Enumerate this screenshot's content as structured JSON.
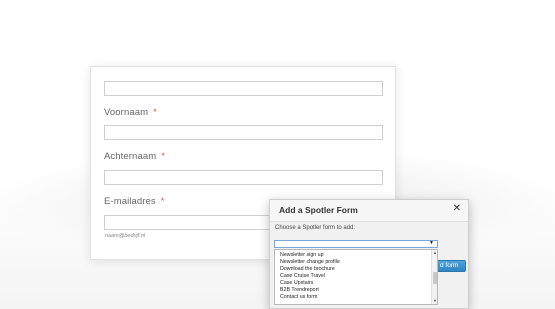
{
  "form": {
    "fields": [
      {
        "label": "",
        "required": false,
        "value": ""
      },
      {
        "label": "Voornaam",
        "required": true,
        "value": ""
      },
      {
        "label": "Achternaam",
        "required": true,
        "value": ""
      },
      {
        "label": "E-mailadres",
        "required": true,
        "value": ""
      }
    ],
    "required_marker": "*",
    "email_hint": "naam@bedrijf.nl"
  },
  "modal": {
    "title": "Add a Spotler Form",
    "close_icon": "close-icon",
    "prompt": "Choose a Spotler form to add:",
    "select": {
      "value": "",
      "options": [
        "Newsletter sign up",
        "Newsletter change profile",
        "Download the brochure",
        "Case Cruise Travel",
        "Case Upstairs",
        "B2B Trendreport",
        "Contact us form"
      ]
    },
    "add_button_label": "d form"
  },
  "colors": {
    "required": "#d9534f",
    "button": "#3a93cf",
    "select_border": "#7aa7d9"
  }
}
